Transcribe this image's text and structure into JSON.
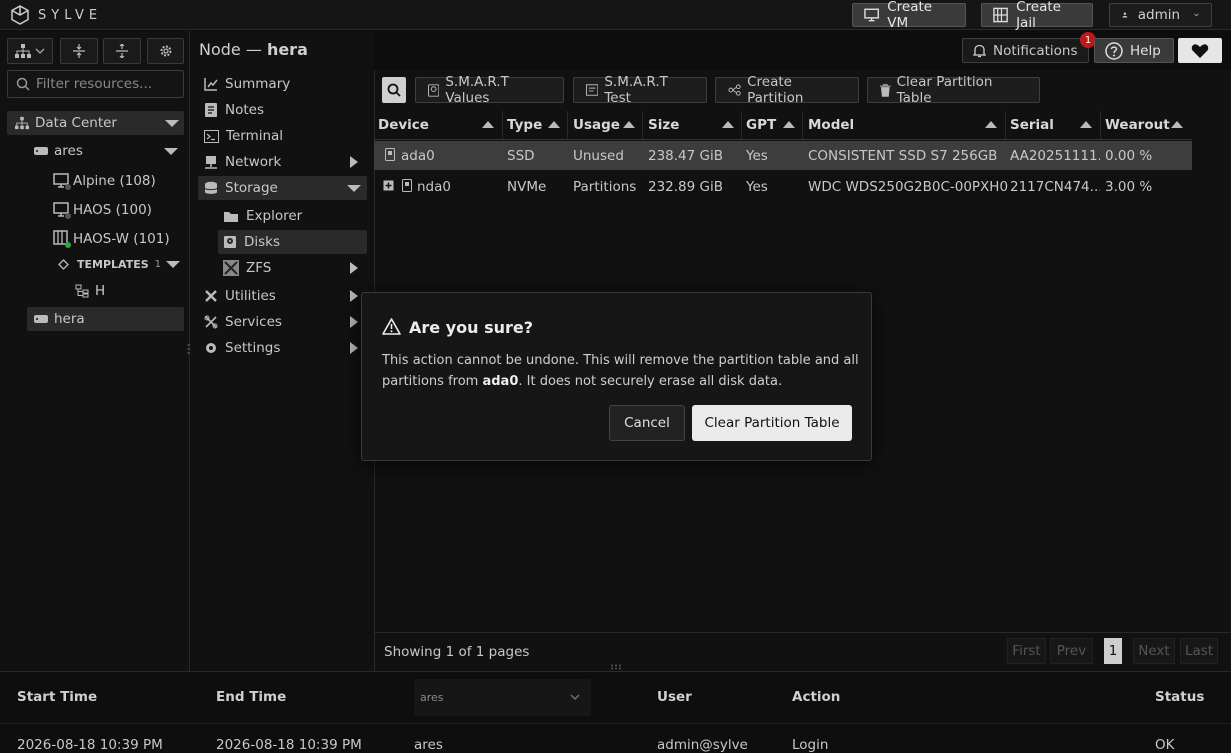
{
  "app": {
    "logo_text": "SYLVE"
  },
  "topbar": {
    "create_vm": "Create VM",
    "create_jail": "Create Jail",
    "user": "admin"
  },
  "left": {
    "filter_placeholder": "Filter resources...",
    "tree": [
      {
        "label": "Data Center"
      },
      {
        "label": "ares"
      },
      {
        "label": "Alpine (108)"
      },
      {
        "label": "HAOS (100)"
      },
      {
        "label": "HAOS-W (101)"
      },
      {
        "label": "TEMPLATES",
        "count": "1"
      },
      {
        "label": "H"
      },
      {
        "label": "hera"
      }
    ]
  },
  "header": {
    "node_prefix": "Node — ",
    "node_name": "hera",
    "notifications": "Notifications",
    "notif_count": "1",
    "help": "Help"
  },
  "nav": {
    "items": [
      {
        "label": "Summary"
      },
      {
        "label": "Notes"
      },
      {
        "label": "Terminal"
      },
      {
        "label": "Network"
      },
      {
        "label": "Storage"
      },
      {
        "label": "Explorer"
      },
      {
        "label": "Disks"
      },
      {
        "label": "ZFS"
      },
      {
        "label": "Utilities"
      },
      {
        "label": "Services"
      },
      {
        "label": "Settings"
      }
    ]
  },
  "toolbar": {
    "smart_values": "S.M.A.R.T Values",
    "smart_test": "S.M.A.R.T Test",
    "create_partition": "Create Partition",
    "clear_partition_table": "Clear Partition Table"
  },
  "table": {
    "columns": [
      "Device",
      "Type",
      "Usage",
      "Size",
      "GPT",
      "Model",
      "Serial",
      "Wearout"
    ],
    "rows": [
      {
        "device": "ada0",
        "type": "SSD",
        "usage": "Unused",
        "size": "238.47 GiB",
        "gpt": "Yes",
        "model": "CONSISTENT SSD S7 256GB",
        "serial": "AA20251111...",
        "wearout": "0.00 %"
      },
      {
        "device": "nda0",
        "type": "NVMe",
        "usage": "Partitions",
        "size": "232.89 GiB",
        "gpt": "Yes",
        "model": "WDC WDS250G2B0C-00PXH0",
        "serial": "2117CN474...",
        "wearout": "3.00 %"
      }
    ],
    "footer": "Showing 1 of 1 pages",
    "pager": {
      "first": "First",
      "prev": "Prev",
      "page": "1",
      "next": "Next",
      "last": "Last"
    }
  },
  "bottom": {
    "headers": {
      "start": "Start Time",
      "end": "End Time",
      "node": "ares",
      "user": "User",
      "action": "Action",
      "status": "Status"
    },
    "row": {
      "start": "2026-08-18 10:39 PM",
      "end": "2026-08-18 10:39 PM",
      "node": "ares",
      "user": "admin@sylve",
      "action": "Login",
      "status": "OK"
    }
  },
  "modal": {
    "title": "Are you sure?",
    "body_1": "This action cannot be undone. This will remove the partition table and all",
    "body_2a": "partitions from ",
    "body_2b": "ada0",
    "body_2c": ". It does not securely erase all disk data.",
    "cancel": "Cancel",
    "confirm": "Clear Partition Table"
  }
}
